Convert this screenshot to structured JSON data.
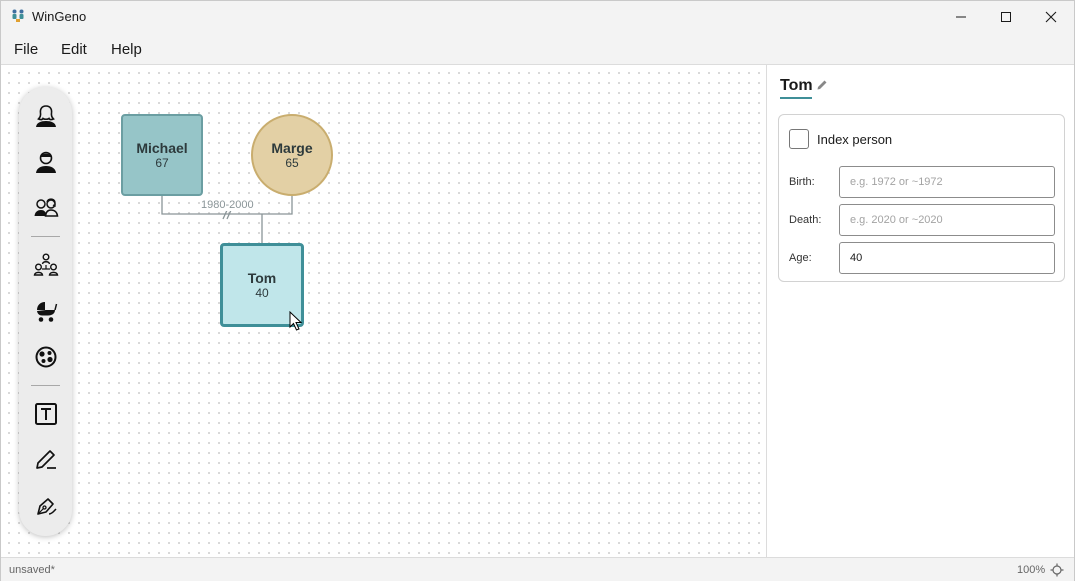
{
  "app": {
    "title": "WinGeno"
  },
  "menu": {
    "file": "File",
    "edit": "Edit",
    "help": "Help"
  },
  "toolbox": {
    "tools": [
      "female-person-icon",
      "male-person-icon",
      "couple-icon",
      "family-icon",
      "stroller-icon",
      "disease-icon",
      "text-box-icon",
      "pen-icon",
      "freehand-draw-icon"
    ]
  },
  "diagram": {
    "persons": [
      {
        "name": "Michael",
        "age": "67",
        "shape": "square",
        "color": "#96c5c8"
      },
      {
        "name": "Marge",
        "age": "65",
        "shape": "circle",
        "color": "#e3d0a5"
      },
      {
        "name": "Tom",
        "age": "40",
        "shape": "square",
        "color": "#c0e6ea",
        "selected": true
      }
    ],
    "relationship": {
      "label": "1980-2000",
      "divorced": true
    }
  },
  "panel": {
    "title": "Tom",
    "index_person_label": "Index person",
    "index_person_checked": false,
    "birth_label": "Birth:",
    "birth_value": "",
    "birth_placeholder": "e.g. 1972 or ~1972",
    "death_label": "Death:",
    "death_value": "",
    "death_placeholder": "e.g. 2020 or ~2020",
    "age_label": "Age:",
    "age_value": "40"
  },
  "status": {
    "left": "unsaved*",
    "zoom": "100%"
  },
  "colors": {
    "accent": "#3f8f98",
    "selected_border": "#3f8f98"
  }
}
